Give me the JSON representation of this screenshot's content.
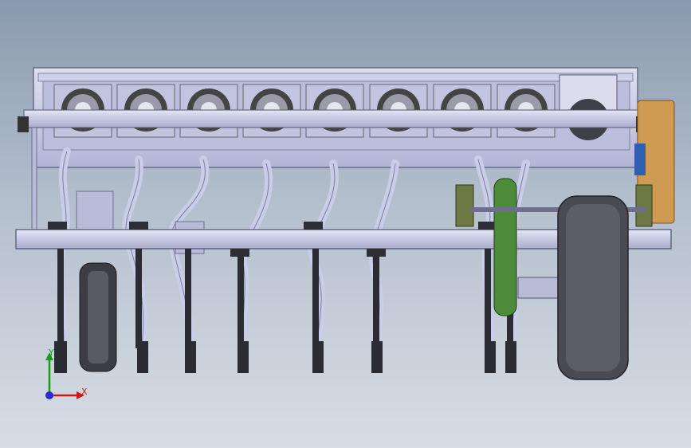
{
  "viewport": {
    "name": "solidworks-graphics-area",
    "background_top": "#8a9aae",
    "background_bottom": "#d7dde5"
  },
  "model": {
    "name": "seed-drill-planter",
    "colors": {
      "frame": "#c6c8e6",
      "frame_dark": "#6c6e8a",
      "hose": "#c9cde8",
      "drive_wheel": "#4d8a3a",
      "gear_box": "#cf9a52",
      "tire": "#4a4a4a",
      "blue_accent": "#2e5fb0"
    },
    "seed_meter_count": 8,
    "opener_count": 9
  },
  "triad": {
    "x_label": "X",
    "y_label": "Y",
    "x_color": "#cc1a1a",
    "y_color": "#1a9a1a",
    "z_color": "#2a2ad0"
  }
}
